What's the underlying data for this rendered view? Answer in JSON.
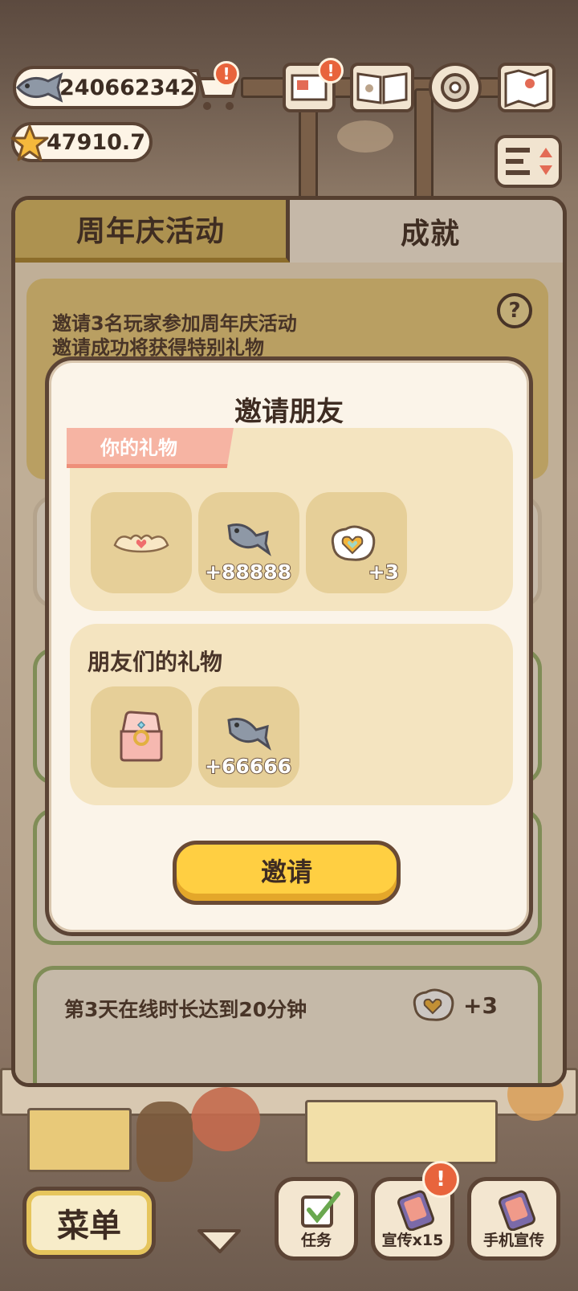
{
  "currency": {
    "fish": "240662342",
    "stars": "47910.7"
  },
  "alerts": {
    "shop": "!",
    "mail": "!",
    "promote": "!"
  },
  "tabs": [
    {
      "label": "周年庆活动",
      "active": true
    },
    {
      "label": "成就",
      "active": false
    }
  ],
  "event": {
    "line1": "邀请3名玩家参加周年庆活动",
    "line2": "邀请成功将获得特别礼物",
    "help": "?"
  },
  "tasks": [
    {
      "text": "第3天在线时长达到20分钟",
      "reward": "+3"
    }
  ],
  "modal": {
    "title": "邀请朋友",
    "your_gifts_label": "你的礼物",
    "your_gifts": [
      {
        "icon": "crown-wings-icon",
        "count": ""
      },
      {
        "icon": "fish-icon",
        "count": "+88888"
      },
      {
        "icon": "heart-egg-icon",
        "count": "+3"
      }
    ],
    "friends_gifts_label": "朋友们的礼物",
    "friends_gifts": [
      {
        "icon": "ring-box-icon",
        "count": ""
      },
      {
        "icon": "fish-icon",
        "count": "+66666"
      }
    ],
    "invite_label": "邀请"
  },
  "bottom_bar": {
    "menu": "菜单",
    "tasks": "任务",
    "promote": "宣传x15",
    "phone_promote": "手机宣传"
  },
  "colors": {
    "tab_active": "#d6b762",
    "invite_button": "#ffcf42",
    "ribbon": "#f6b4a3",
    "task_border": "#97b16b",
    "alert": "#e8643c"
  }
}
